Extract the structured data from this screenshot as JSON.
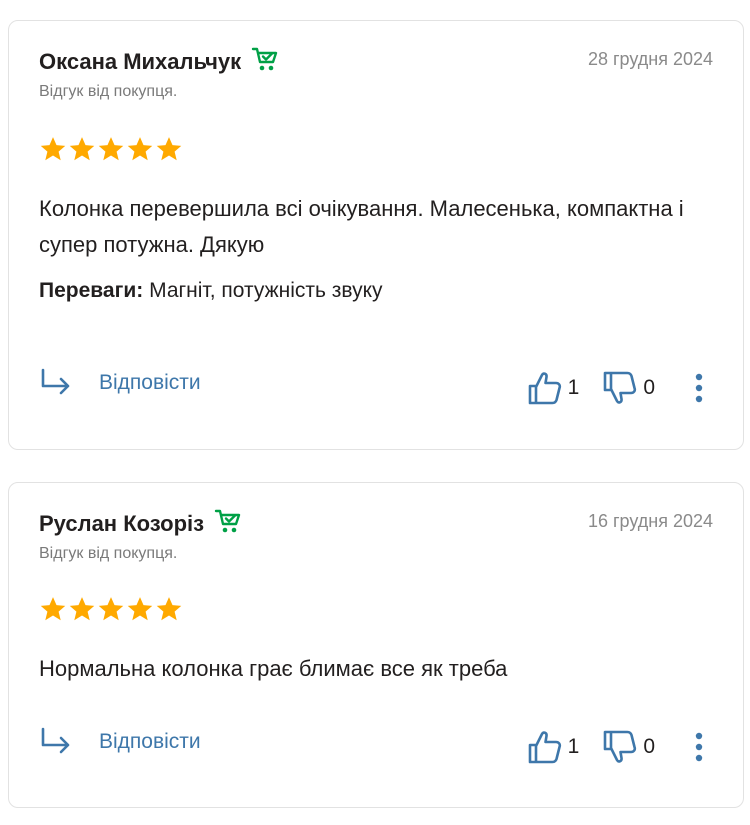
{
  "colors": {
    "accent": "#3e77aa",
    "star": "#ffa900",
    "buyer_green": "#00a046"
  },
  "reviews": [
    {
      "author": "Оксана Михальчук",
      "date": "28 грудня 2024",
      "subtitle": "Відгук від покупця.",
      "rating": 5,
      "text": "Колонка перевершила всі очікування. Малесенька, компактна і супер потужна. Дякую",
      "pros_label": "Переваги:",
      "pros": "Магніт, потужність звуку",
      "reply_label": "Відповісти",
      "likes": "1",
      "dislikes": "0"
    },
    {
      "author": "Руслан Козоріз",
      "date": "16 грудня 2024",
      "subtitle": "Відгук від покупця.",
      "rating": 5,
      "text": "Нормальна колонка грає блимає все як треба",
      "reply_label": "Відповісти",
      "likes": "1",
      "dislikes": "0"
    }
  ],
  "icons": {
    "buyer": "buyer-cart-check-icon",
    "star": "star-icon",
    "reply": "reply-arrow-icon",
    "like": "thumbs-up-icon",
    "dislike": "thumbs-down-icon",
    "more": "more-vertical-icon"
  }
}
